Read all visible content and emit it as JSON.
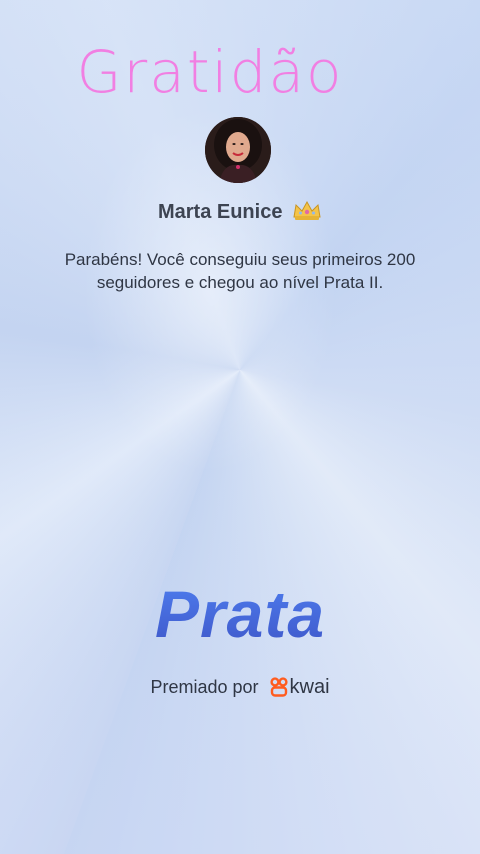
{
  "header": {
    "title": "Gratidão"
  },
  "profile": {
    "name": "Marta Eunice",
    "badge_icon": "crown-icon"
  },
  "message": {
    "text": "Parabéns! Você conseguiu seus primeiros 200 seguidores e chegou ao nível Prata II."
  },
  "level": {
    "name": "Prata"
  },
  "footer": {
    "awarded_by": "Premiado por",
    "brand": "kwai",
    "brand_icon": "kwai-logo-icon"
  },
  "colors": {
    "title": "#f17fe2",
    "level_gradient_top": "#4f7ff0",
    "level_gradient_bottom": "#3e56c8",
    "kwai_orange": "#ff5c1f"
  }
}
